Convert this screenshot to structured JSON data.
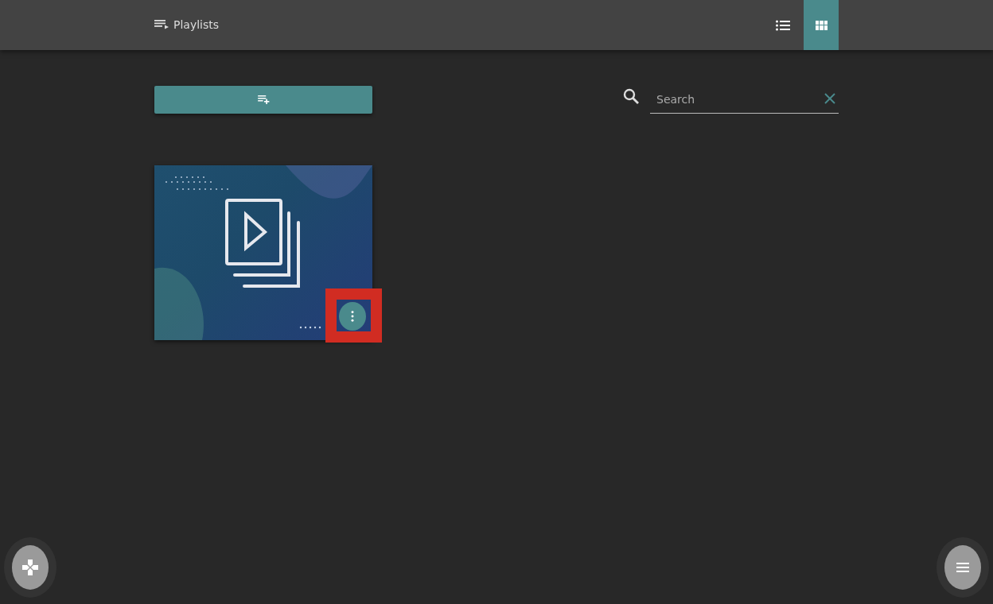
{
  "header": {
    "title": "Playlists",
    "views": [
      {
        "kind": "list",
        "selected": false
      },
      {
        "kind": "grid",
        "selected": true
      }
    ]
  },
  "search": {
    "placeholder": "Search"
  },
  "playlists": [
    {
      "menu_highlighted": true
    }
  ]
}
